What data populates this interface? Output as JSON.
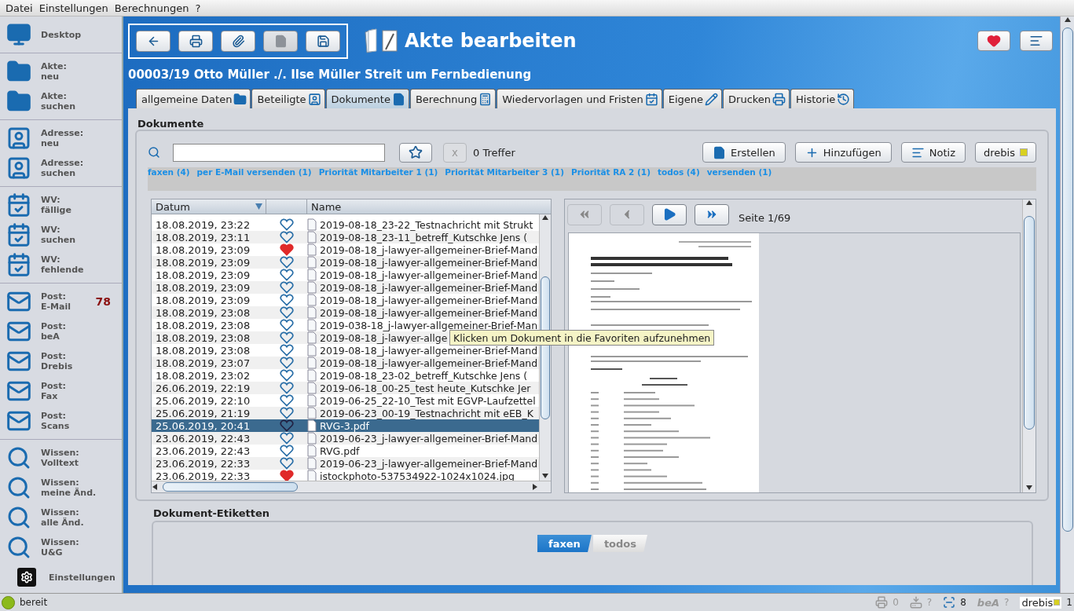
{
  "menu": [
    "Datei",
    "Einstellungen",
    "Berechnungen",
    "?"
  ],
  "sidebar": {
    "groups": [
      {
        "items": [
          {
            "label": "Desktop"
          }
        ]
      },
      {
        "items": [
          {
            "label": "Akte:",
            "sub": "neu"
          },
          {
            "label": "Akte:",
            "sub": "suchen"
          }
        ]
      },
      {
        "items": [
          {
            "label": "Adresse:",
            "sub": "neu"
          },
          {
            "label": "Adresse:",
            "sub": "suchen"
          }
        ]
      },
      {
        "items": [
          {
            "label": "WV:",
            "sub": "fällige"
          },
          {
            "label": "WV:",
            "sub": "suchen"
          },
          {
            "label": "WV:",
            "sub": "fehlende"
          }
        ]
      },
      {
        "items": [
          {
            "label": "Post:",
            "sub": "E-Mail",
            "badge": "78"
          },
          {
            "label": "Post:",
            "sub": "beA"
          },
          {
            "label": "Post:",
            "sub": "Drebis"
          },
          {
            "label": "Post:",
            "sub": "Fax"
          },
          {
            "label": "Post:",
            "sub": "Scans"
          }
        ]
      },
      {
        "items": [
          {
            "label": "Wissen:",
            "sub": "Volltext"
          },
          {
            "label": "Wissen:",
            "sub": "meine Änd."
          },
          {
            "label": "Wissen:",
            "sub": "alle Änd."
          },
          {
            "label": "Wissen:",
            "sub": "U&G"
          }
        ]
      }
    ],
    "settings": "Einstellungen"
  },
  "toolbar": [
    {
      "disabled": false
    },
    {
      "disabled": false
    },
    {
      "disabled": false
    },
    {
      "disabled": true
    },
    {
      "disabled": false
    }
  ],
  "title": "Akte bearbeiten",
  "case": "00003/19 Otto Müller ./. Ilse Müller Streit um Fernbedienung",
  "tabs": [
    {
      "label": "allgemeine Daten",
      "selected": false
    },
    {
      "label": "Beteiligte",
      "selected": false
    },
    {
      "label": "Dokumente",
      "selected": true
    },
    {
      "label": "Berechnung",
      "selected": false
    },
    {
      "label": "Wiedervorlagen und Fristen",
      "selected": false
    },
    {
      "label": "Eigene",
      "selected": false
    },
    {
      "label": "Drucken",
      "selected": false
    },
    {
      "label": "Historie",
      "selected": false
    }
  ],
  "section_title": "Dokumente",
  "search": {
    "clear": "x",
    "hits": "0 Treffer"
  },
  "actions": [
    "Erstellen",
    "Hinzufügen",
    "Notiz",
    "drebis"
  ],
  "tag_filters": [
    "faxen (4)",
    "per E-Mail versenden (1)",
    "Priorität Mitarbeiter 1 (1)",
    "Priorität Mitarbeiter 3 (1)",
    "Priorität RA 2 (1)",
    "todos (4)",
    "versenden (1)"
  ],
  "table": {
    "columns": [
      {
        "label": "Datum",
        "sorted": true
      },
      {
        "label": "Name",
        "sorted": false
      }
    ],
    "rows": [
      {
        "date": "18.08.2019, 23:22",
        "favorite": false,
        "name": "2019-08-18_23-22_Testnachricht mit Strukt",
        "selected": false
      },
      {
        "date": "18.08.2019, 23:11",
        "favorite": false,
        "name": "2019-08-18_23-11_betreff_Kutschke  Jens (",
        "selected": false
      },
      {
        "date": "18.08.2019, 23:09",
        "favorite": true,
        "name": "2019-08-18_j-lawyer-allgemeiner-Brief-Mand",
        "selected": false
      },
      {
        "date": "18.08.2019, 23:09",
        "favorite": false,
        "name": "2019-08-18_j-lawyer-allgemeiner-Brief-Mand",
        "selected": false
      },
      {
        "date": "18.08.2019, 23:09",
        "favorite": false,
        "name": "2019-08-18_j-lawyer-allgemeiner-Brief-Mand",
        "selected": false
      },
      {
        "date": "18.08.2019, 23:09",
        "favorite": false,
        "name": "2019-08-18_j-lawyer-allgemeiner-Brief-Mand",
        "selected": false
      },
      {
        "date": "18.08.2019, 23:09",
        "favorite": false,
        "name": "2019-08-18_j-lawyer-allgemeiner-Brief-Mand",
        "selected": false
      },
      {
        "date": "18.08.2019, 23:08",
        "favorite": false,
        "name": "2019-08-18_j-lawyer-allgemeiner-Brief-Mand",
        "selected": false
      },
      {
        "date": "18.08.2019, 23:08",
        "favorite": false,
        "name": "2019-038-18_j-lawyer-allgemeiner-Brief-Man",
        "selected": false
      },
      {
        "date": "18.08.2019, 23:08",
        "favorite": false,
        "name": "2019-08-18_j-lawyer-allge",
        "selected": false
      },
      {
        "date": "18.08.2019, 23:08",
        "favorite": false,
        "name": "2019-08-18_j-lawyer-allgemeiner-Brief-Mand",
        "selected": false
      },
      {
        "date": "18.08.2019, 23:07",
        "favorite": false,
        "name": "2019-08-18_j-lawyer-allgemeiner-Brief-Mand",
        "selected": false
      },
      {
        "date": "18.08.2019, 23:02",
        "favorite": false,
        "name": "2019-08-18_23-02_betreff_Kutschke  Jens (",
        "selected": false
      },
      {
        "date": "26.06.2019, 22:19",
        "favorite": false,
        "name": "2019-06-18_00-25_test heute_Kutschke  Jer",
        "selected": false
      },
      {
        "date": "25.06.2019, 22:10",
        "favorite": false,
        "name": "2019-06-25_22-10_Test mit EGVP-Laufzettel",
        "selected": false
      },
      {
        "date": "25.06.2019, 21:19",
        "favorite": false,
        "name": "2019-06-23_00-19_Testnachricht mit eEB_K",
        "selected": false
      },
      {
        "date": "25.06.2019, 20:41",
        "favorite": false,
        "name": "RVG-3.pdf",
        "selected": true
      },
      {
        "date": "23.06.2019, 22:43",
        "favorite": false,
        "name": "2019-06-23_j-lawyer-allgemeiner-Brief-Mand",
        "selected": false
      },
      {
        "date": "23.06.2019, 22:43",
        "favorite": false,
        "name": "RVG.pdf",
        "selected": false
      },
      {
        "date": "23.06.2019, 22:33",
        "favorite": false,
        "name": "2019-06-23_j-lawyer-allgemeiner-Brief-Mand",
        "selected": false
      },
      {
        "date": "23.06.2019, 22:33",
        "favorite": true,
        "name": "istockphoto-537534922-1024x1024.jpg",
        "selected": false
      }
    ]
  },
  "tooltip": "Klicken um Dokument in die Favoriten aufzunehmen",
  "preview": {
    "nav": [
      {
        "disabled": true
      },
      {
        "disabled": true
      },
      {
        "disabled": false
      },
      {
        "disabled": false
      }
    ],
    "page": "Seite 1/69"
  },
  "labels_title": "Dokument-Etiketten",
  "labels": [
    {
      "label": "faxen",
      "active": true
    },
    {
      "label": "todos",
      "active": false
    }
  ],
  "status": {
    "text": "bereit",
    "items": [
      {
        "value": "0"
      },
      {
        "value": "?"
      },
      {
        "value": "8"
      },
      {
        "label": "beA",
        "value": "?"
      },
      {
        "label": "drebis",
        "value": "1"
      }
    ]
  }
}
